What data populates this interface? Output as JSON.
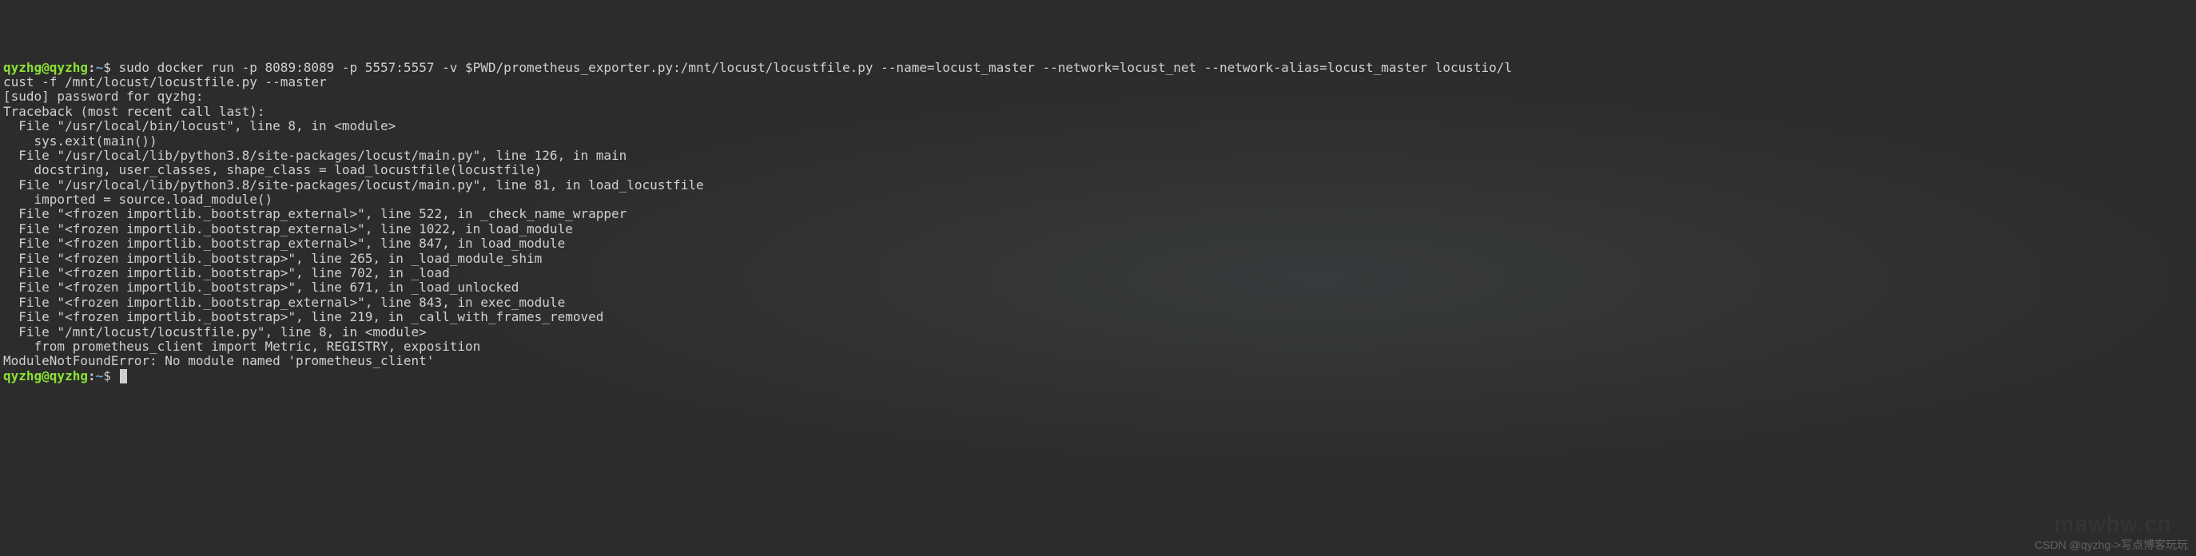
{
  "prompt1": {
    "user": "qyzhg@qyzhg",
    "sep": ":",
    "path": "~",
    "dollar": "$ "
  },
  "command_line1": "sudo docker run -p 8089:8089 -p 5557:5557 -v $PWD/prometheus_exporter.py:/mnt/locust/locustfile.py --name=locust_master --network=locust_net --network-alias=locust_master locustio/l",
  "command_line2": "cust -f /mnt/locust/locustfile.py --master",
  "output_lines": [
    "[sudo] password for qyzhg: ",
    "Traceback (most recent call last):",
    "  File \"/usr/local/bin/locust\", line 8, in <module>",
    "    sys.exit(main())",
    "  File \"/usr/local/lib/python3.8/site-packages/locust/main.py\", line 126, in main",
    "    docstring, user_classes, shape_class = load_locustfile(locustfile)",
    "  File \"/usr/local/lib/python3.8/site-packages/locust/main.py\", line 81, in load_locustfile",
    "    imported = source.load_module()",
    "  File \"<frozen importlib._bootstrap_external>\", line 522, in _check_name_wrapper",
    "  File \"<frozen importlib._bootstrap_external>\", line 1022, in load_module",
    "  File \"<frozen importlib._bootstrap_external>\", line 847, in load_module",
    "  File \"<frozen importlib._bootstrap>\", line 265, in _load_module_shim",
    "  File \"<frozen importlib._bootstrap>\", line 702, in _load",
    "  File \"<frozen importlib._bootstrap>\", line 671, in _load_unlocked",
    "  File \"<frozen importlib._bootstrap_external>\", line 843, in exec_module",
    "  File \"<frozen importlib._bootstrap>\", line 219, in _call_with_frames_removed",
    "  File \"/mnt/locust/locustfile.py\", line 8, in <module>",
    "    from prometheus_client import Metric, REGISTRY, exposition",
    "ModuleNotFoundError: No module named 'prometheus_client'"
  ],
  "prompt2": {
    "user": "qyzhg@qyzhg",
    "sep": ":",
    "path": "~",
    "dollar": "$ "
  },
  "watermark": "CSDN @qyzhg->写点博客玩玩",
  "watermark_bg": "mawhw.cn"
}
